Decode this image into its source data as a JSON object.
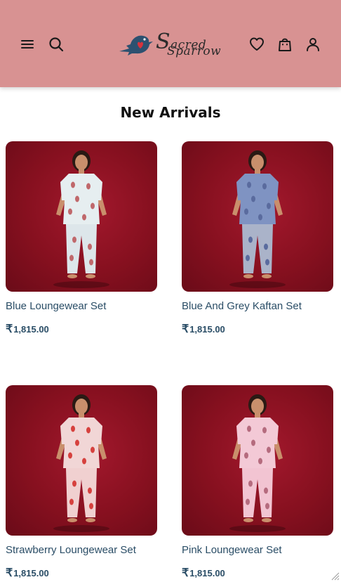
{
  "header": {
    "brand_line1": "acred",
    "brand_line1_initial": "S",
    "brand_line2": "parrow",
    "brand_line2_initial": "S",
    "background": "#d89292"
  },
  "section": {
    "title": "New Arrivals"
  },
  "products": [
    {
      "name": "Blue Loungewear Set",
      "currency": "₹",
      "price": "1,815.00",
      "top_color": "#e6eef0",
      "bottom_color": "#dde6ea",
      "print_color": "#c0686b"
    },
    {
      "name": "Blue And Grey Kaftan Set",
      "currency": "₹",
      "price": "1,815.00",
      "top_color": "#7f93c2",
      "bottom_color": "#aab3c9",
      "print_color": "#5a6b9e"
    },
    {
      "name": "Strawberry Loungewear Set",
      "currency": "₹",
      "price": "1,815.00",
      "top_color": "#f1d6d6",
      "bottom_color": "#f0d0d0",
      "print_color": "#d6413e"
    },
    {
      "name": "Pink Loungewear Set",
      "currency": "₹",
      "price": "1,815.00",
      "top_color": "#f3c9d6",
      "bottom_color": "#f2c4d2",
      "print_color": "#b56b7e"
    }
  ],
  "icons": {
    "menu": "menu-icon",
    "search": "search-icon",
    "wishlist": "heart-icon",
    "cart": "shopping-bag-icon",
    "account": "user-icon"
  }
}
